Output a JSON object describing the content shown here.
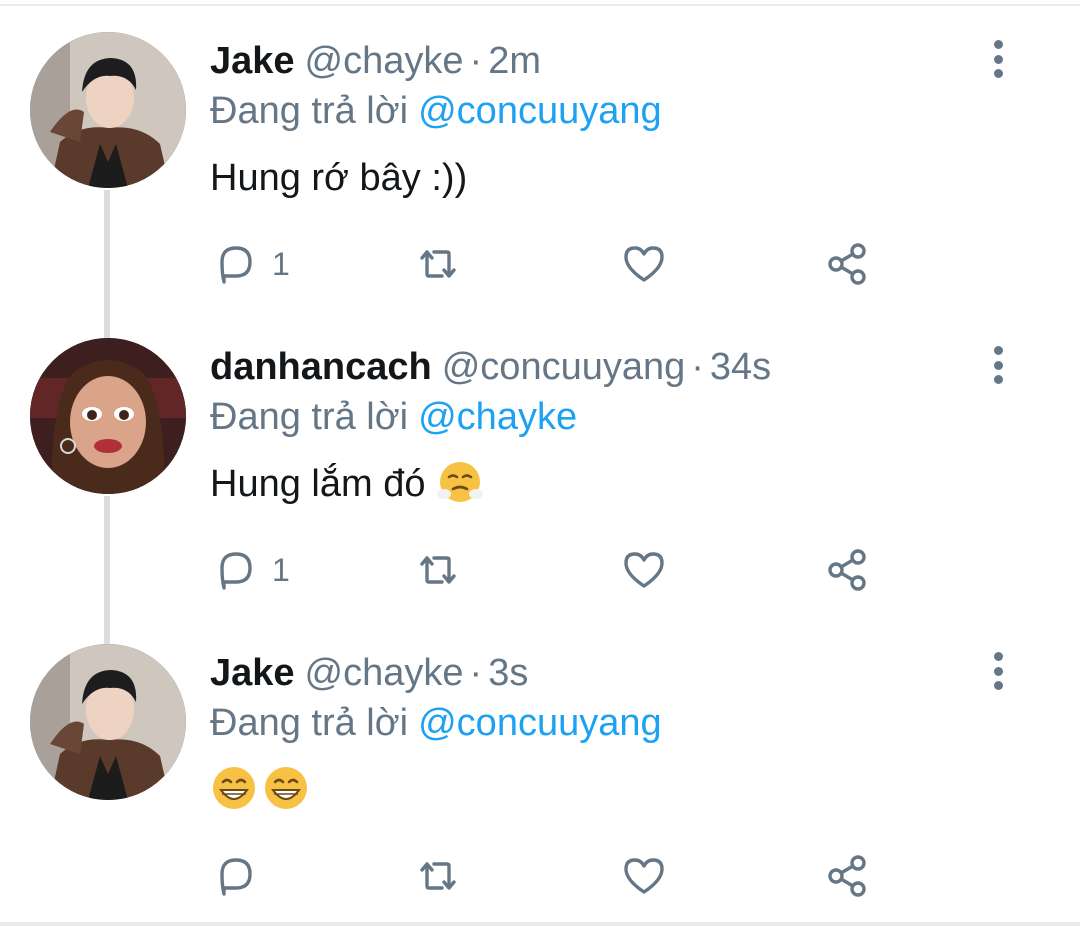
{
  "theme": {
    "text_primary": "#14171a",
    "text_secondary": "#657786",
    "link": "#1da1f2",
    "thread_line": "#d9dde0"
  },
  "tweets": [
    {
      "display_name": "Jake",
      "handle": "@chayke",
      "separator": "·",
      "time": "2m",
      "reply_prefix": "Đang trả lời",
      "reply_to": "@concuuyang",
      "text": "Hung rớ bây :))",
      "emoji": [],
      "reply_count": "1",
      "icons": [
        "reply-icon",
        "retweet-icon",
        "like-icon",
        "share-icon",
        "more-icon"
      ]
    },
    {
      "display_name": "danhancach",
      "handle": "@concuuyang",
      "separator": "·",
      "time": "34s",
      "reply_prefix": "Đang trả lời",
      "reply_to": "@chayke",
      "text": "Hung lắm đó",
      "emoji": [
        "face-with-steam-emoji"
      ],
      "reply_count": "1",
      "icons": [
        "reply-icon",
        "retweet-icon",
        "like-icon",
        "share-icon",
        "more-icon"
      ]
    },
    {
      "display_name": "Jake",
      "handle": "@chayke",
      "separator": "·",
      "time": "3s",
      "reply_prefix": "Đang trả lời",
      "reply_to": "@concuuyang",
      "text": "",
      "emoji": [
        "grinning-face-emoji",
        "grinning-face-emoji"
      ],
      "reply_count": "",
      "icons": [
        "reply-icon",
        "retweet-icon",
        "like-icon",
        "share-icon",
        "more-icon"
      ]
    }
  ]
}
